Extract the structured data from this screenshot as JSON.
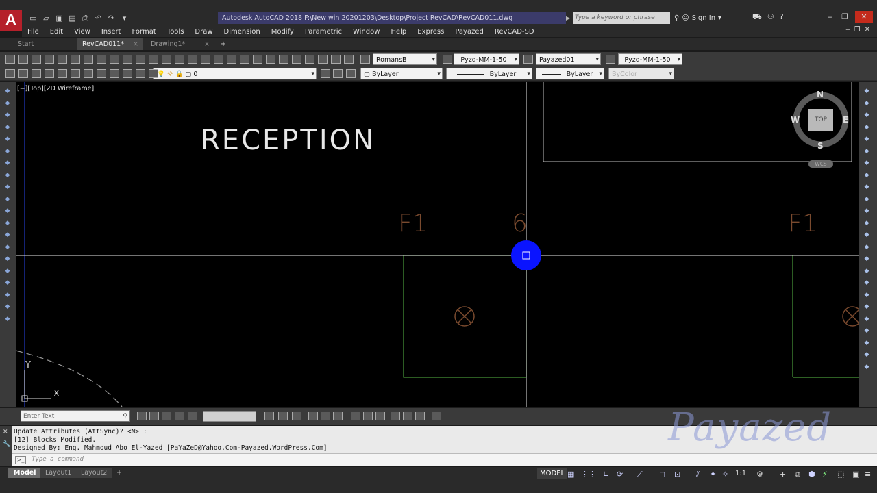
{
  "app": {
    "logo": "A",
    "title": "Autodesk AutoCAD 2018    F:\\New win 20201203\\Desktop\\Project RevCAD\\RevCAD011.dwg",
    "search_placeholder": "Type a keyword or phrase",
    "sign_in": "Sign In"
  },
  "menu": [
    "File",
    "Edit",
    "View",
    "Insert",
    "Format",
    "Tools",
    "Draw",
    "Dimension",
    "Modify",
    "Parametric",
    "Window",
    "Help",
    "Express",
    "Payazed",
    "RevCAD-SD"
  ],
  "tabs": [
    {
      "label": "Start"
    },
    {
      "label": "RevCAD011*"
    },
    {
      "label": "Drawing1*"
    }
  ],
  "toolbar1": {
    "text_style": "RomansB",
    "dim_style": "Pyzd-MM-1-50",
    "table_style": "Payazed01",
    "multileader_style": "Pyzd-MM-1-50"
  },
  "toolbar2": {
    "layer": "0",
    "color": "ByLayer",
    "linetype": "ByLayer",
    "lineweight": "ByLayer",
    "plotstyle": "ByColor"
  },
  "viewport": {
    "label": "[−][Top][2D Wireframe]",
    "texts": {
      "reception": "RECEPTION",
      "f1_left": "F1",
      "six": "6",
      "f1_right": "F1"
    },
    "viewcube": {
      "n": "N",
      "s": "S",
      "e": "E",
      "w": "W",
      "top": "TOP",
      "wcs": "WCS"
    },
    "ucs": {
      "x": "X",
      "y": "Y"
    }
  },
  "drawbar": {
    "enter_text_placeholder": "Enter Text"
  },
  "command": {
    "history": [
      "Update Attributes (AttSync)? <N> :",
      "[12] Blocks Modified.",
      "Designed By: Eng. Mahmoud Abo El-Yazed [PaYaZeD@Yahoo.Com-Payazed.WordPress.Com]"
    ],
    "placeholder": "Type a command"
  },
  "watermark": "Payazed",
  "status": {
    "layout_tabs": [
      "Model",
      "Layout1",
      "Layout2"
    ],
    "model_button": "MODEL",
    "scale": "1:1"
  },
  "colors": {
    "canvas": "#000000",
    "green_lines": "#4a9a3a",
    "crosshair": "#ffffff",
    "grip": "#0a14ff",
    "fixture": "#7a4a2e"
  },
  "icons": {
    "qat": [
      "new-icon",
      "open-icon",
      "save-icon",
      "saveas-icon",
      "print-icon",
      "undo-icon",
      "redo-icon"
    ],
    "viewcube": "compass-icon",
    "crosshair_grip": "grip-icon"
  }
}
